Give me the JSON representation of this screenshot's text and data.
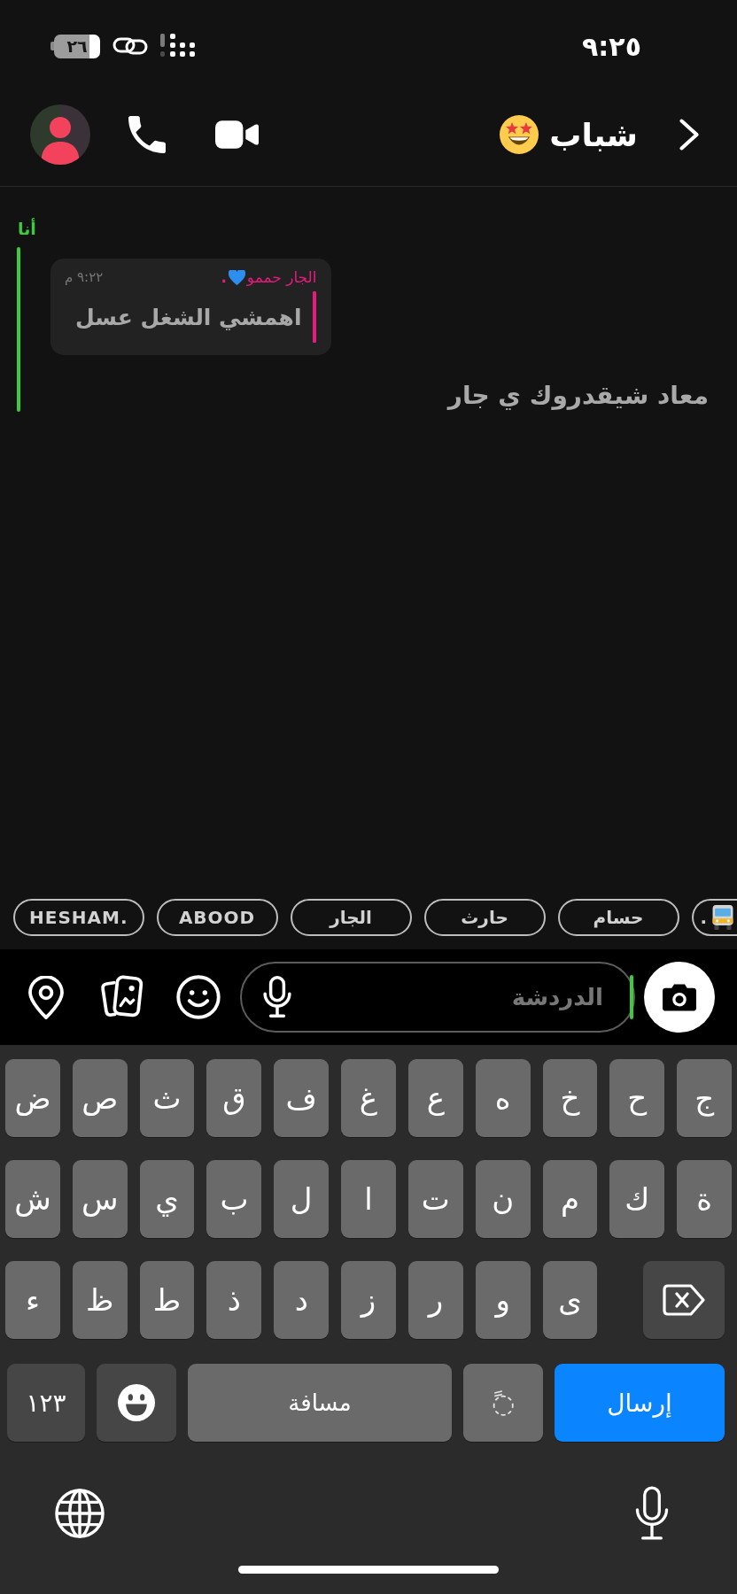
{
  "status_bar": {
    "time": "٩:٢٥",
    "battery": "٢٦"
  },
  "header": {
    "title": "شباب"
  },
  "messages": [
    {
      "sender": "أنا",
      "color": "#3fc93c",
      "quote": {
        "sender": "الجار حممو",
        "sender_suffix": ".",
        "time": "٩:٢٢ م",
        "text": "اهمشي الشغل عسل",
        "color": "#e8197f"
      },
      "text": "معاد شيقدروك ي جار"
    }
  ],
  "mention_chips": [
    {
      "kind": "emoji",
      "label": "."
    },
    {
      "kind": "text",
      "label": "حسام"
    },
    {
      "kind": "text",
      "label": "حارث"
    },
    {
      "kind": "text",
      "label": "الجار"
    },
    {
      "kind": "text",
      "label": "ABOOD"
    },
    {
      "kind": "text",
      "label": "HESHAM."
    }
  ],
  "composer": {
    "placeholder": "الدردشة"
  },
  "keyboard": {
    "letter_rows": [
      [
        "ج",
        "ح",
        "خ",
        "ه",
        "ع",
        "غ",
        "ف",
        "ق",
        "ث",
        "ص",
        "ض"
      ],
      [
        "ة",
        "ك",
        "م",
        "ن",
        "ت",
        "ا",
        "ل",
        "ب",
        "ي",
        "س",
        "ش"
      ],
      [
        "ى",
        "و",
        "ر",
        "ز",
        "د",
        "ذ",
        "ط",
        "ظ",
        "ء"
      ]
    ],
    "bottom_row": [
      {
        "kind": "send",
        "label": "إرسال"
      },
      {
        "kind": "diacritic",
        "label": "◌ً"
      },
      {
        "kind": "space",
        "label": "مسافة"
      },
      {
        "kind": "emoji"
      },
      {
        "kind": "numbers",
        "label": "١٢٣"
      }
    ]
  }
}
